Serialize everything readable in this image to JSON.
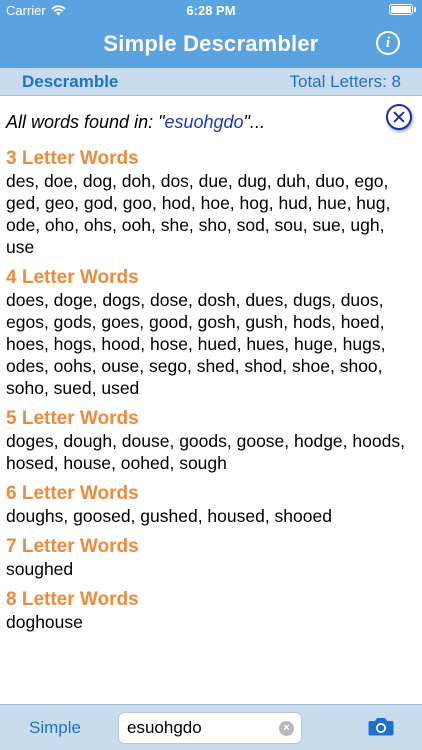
{
  "status": {
    "carrier": "Carrier",
    "time": "6:28 PM",
    "battery_level": 1.0
  },
  "nav": {
    "title": "Simple Descrambler",
    "info_label": "i"
  },
  "subbar": {
    "mode": "Descramble",
    "total_letters": "Total Letters: 8"
  },
  "results": {
    "prefix": "All words found in: \"",
    "query": "esuohgdo",
    "suffix": "\"...",
    "sections": [
      {
        "title": "3 Letter Words",
        "words": "des, doe, dog, doh, dos, due, dug, duh, duo, ego, ged, geo, god, goo, hod, hoe, hog, hud, hue, hug, ode, oho, ohs, ooh, she, sho, sod, sou, sue, ugh, use"
      },
      {
        "title": "4 Letter Words",
        "words": "does, doge, dogs, dose, dosh, dues, dugs, duos, egos, gods, goes, good, gosh, gush, hods, hoed, hoes, hogs, hood, hose, hued, hues, huge, hugs, odes, oohs, ouse, sego, shed, shod, shoe, shoo, soho, sued, used"
      },
      {
        "title": "5 Letter Words",
        "words": "doges, dough, douse, goods, goose, hodge, hoods, hosed, house, oohed, sough"
      },
      {
        "title": "6 Letter Words",
        "words": "doughs, goosed, gushed, housed, shooed"
      },
      {
        "title": "7 Letter Words",
        "words": "soughed"
      },
      {
        "title": "8 Letter Words",
        "words": "doghouse"
      }
    ]
  },
  "bottom": {
    "mode_button": "Simple",
    "search_value": "esuohgdo",
    "clear_label": "×"
  },
  "colors": {
    "nav": "#5aa3e0",
    "subbar": "#c9dcee",
    "link": "#1f6fd1",
    "heading": "#ef8a3a",
    "query": "#1a37c8"
  }
}
